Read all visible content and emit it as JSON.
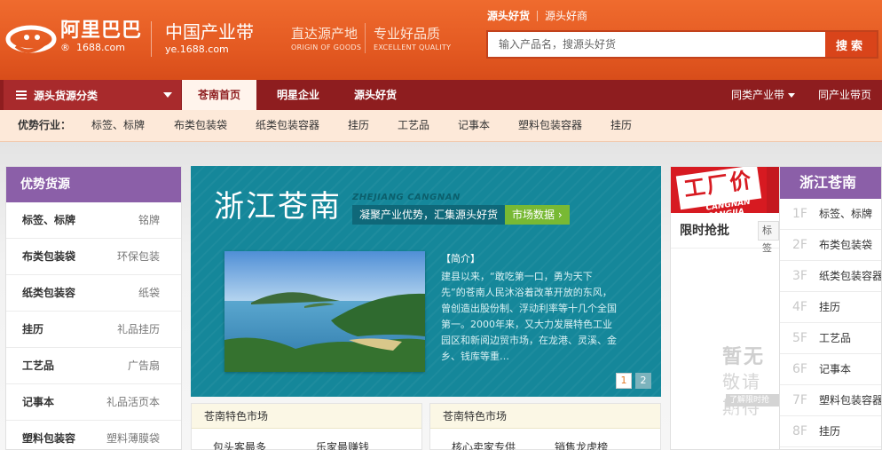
{
  "header": {
    "logo": {
      "cn": "阿里巴巴",
      "en": "1688.com",
      "reg": "®"
    },
    "site": {
      "cn": "中国产业带",
      "en": "ye.1688.com"
    },
    "slogans": [
      {
        "cn": "直达源产地",
        "en": "ORIGIN OF GOODS"
      },
      {
        "cn": "专业好品质",
        "en": "EXCELLENT QUALITY"
      }
    ],
    "search": {
      "tabs": [
        "源头好货",
        "源头好商"
      ],
      "placeholder": "输入产品名，搜源头好货",
      "button": "搜索"
    }
  },
  "nav": {
    "category_menu": "源头货源分类",
    "items": [
      "苍南首页",
      "明星企业",
      "源头好货"
    ],
    "right": [
      "同类产业带",
      "同产业带页"
    ]
  },
  "industry": {
    "label": "优势行业：",
    "items": [
      "标签、标牌",
      "布类包装袋",
      "纸类包装容器",
      "挂历",
      "工艺品",
      "记事本",
      "塑料包装容器",
      "挂历"
    ]
  },
  "left_panel": {
    "title": "优势货源",
    "items": [
      {
        "name": "标签、标牌",
        "sub": "铭牌"
      },
      {
        "name": "布类包装袋",
        "sub": "环保包装"
      },
      {
        "name": "纸类包装容",
        "sub": "纸袋"
      },
      {
        "name": "挂历",
        "sub": "礼品挂历"
      },
      {
        "name": "工艺品",
        "sub": "广告扇"
      },
      {
        "name": "记事本",
        "sub": "礼品活页本"
      },
      {
        "name": "塑料包装容",
        "sub": "塑料薄膜袋"
      }
    ]
  },
  "feature": {
    "title": "浙江苍南",
    "pinyin": "ZHEJIANG CANGNAN",
    "tagline": "凝聚产业优势，汇集源头好货",
    "market_button": "市场数据",
    "intro_heading": "【简介】",
    "intro": "建县以来，“敢吃第一口，勇为天下先”的苍南人民沐浴着改革开放的东风，曾创造出股份制、浮动利率等十几个全国第一。2000年来，又大力发展特色工业园区和新阅边贸市场，在龙港、灵溪、金乡、钱库等重…",
    "pages": [
      "1",
      "2"
    ]
  },
  "markets": [
    {
      "title": "苍南特色市场",
      "items": [
        "包头客最多",
        "乐家最赚钱"
      ]
    },
    {
      "title": "苍南特色市场",
      "items": [
        "核心卖家专供",
        "销售龙虎榜"
      ]
    }
  ],
  "promo": {
    "banner": "工厂价",
    "banner_pinyin": "CANGNAN CANGJIA",
    "flash_title": "限时抢批",
    "flash_tag": "标签",
    "empty_line1": "暂无",
    "empty_line2": "敬请期待",
    "empty_line3": "了解限时抢批"
  },
  "floors": {
    "title": "浙江苍南",
    "items": [
      {
        "no": "1F",
        "label": "标签、标牌"
      },
      {
        "no": "2F",
        "label": "布类包装袋"
      },
      {
        "no": "3F",
        "label": "纸类包装容器"
      },
      {
        "no": "4F",
        "label": "挂历"
      },
      {
        "no": "5F",
        "label": "工艺品"
      },
      {
        "no": "6F",
        "label": "记事本"
      },
      {
        "no": "7F",
        "label": "塑料包装容器"
      },
      {
        "no": "8F",
        "label": "挂历"
      }
    ]
  },
  "colors": {
    "header_orange": "#e45a22",
    "nav_maroon": "#8e1d1f",
    "purple": "#8b5fa8",
    "teal": "#15879a",
    "green": "#78b934",
    "promo_red": "#d71a21"
  }
}
